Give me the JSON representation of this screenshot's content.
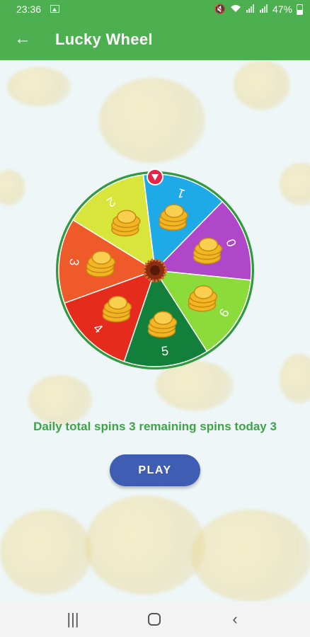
{
  "status_bar": {
    "time": "23:36",
    "battery_percent": "47%",
    "icons": [
      "image-icon",
      "mute-icon",
      "wifi-icon",
      "signal-icon",
      "signal-icon-2",
      "battery-icon"
    ]
  },
  "app_bar": {
    "title": "Lucky Wheel",
    "back_icon": "arrow-left-icon"
  },
  "wheel": {
    "segments": [
      {
        "label": "1",
        "color": "#1ea9e7"
      },
      {
        "label": "0",
        "color": "#b047c8"
      },
      {
        "label": "6",
        "color": "#8bdb3a"
      },
      {
        "label": "5",
        "color": "#127f3a"
      },
      {
        "label": "4",
        "color": "#e42b1c"
      },
      {
        "label": "3",
        "color": "#ee5a2a"
      },
      {
        "label": "2",
        "color": "#d8e63b"
      }
    ],
    "rim_color": "#2f9a3e",
    "pointer_color": "#e8234a",
    "coin_icon": "gold-coins-icon",
    "hub_icon": "wheel-hub-icon"
  },
  "info": {
    "text": "Daily total spins 3 remaining spins today 3",
    "color": "#3fa447"
  },
  "play_button": {
    "label": "PLAY",
    "color": "#3f5eb3"
  },
  "nav_bar": {
    "recent_icon": "recent-apps-icon",
    "home_icon": "home-icon",
    "back_icon": "back-icon"
  },
  "colors": {
    "primary": "#4caf50",
    "background": "#eef6f7"
  }
}
